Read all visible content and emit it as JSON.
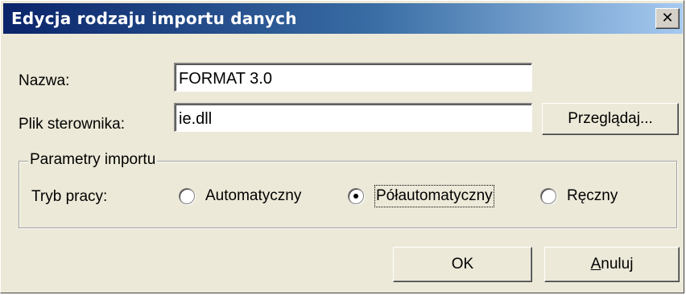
{
  "window": {
    "title": "Edycja rodzaju importu danych",
    "close_glyph": "✕"
  },
  "form": {
    "name_label": "Nazwa:",
    "name_value": "FORMAT 3.0",
    "driver_label": "Plik sterownika:",
    "driver_value": "ie.dll",
    "browse_label": "Przeglądaj..."
  },
  "import_params": {
    "legend": "Parametry importu",
    "mode_label": "Tryb pracy:",
    "options": [
      {
        "label": "Automatyczny",
        "selected": false
      },
      {
        "label": "Półautomatyczny",
        "selected": true
      },
      {
        "label": "Ręczny",
        "selected": false
      }
    ]
  },
  "buttons": {
    "ok_label": "OK",
    "cancel_label": "Anuluj"
  },
  "colors": {
    "titlebar_start": "#0a246a",
    "titlebar_end": "#a6caf0",
    "face": "#ece9d8"
  }
}
